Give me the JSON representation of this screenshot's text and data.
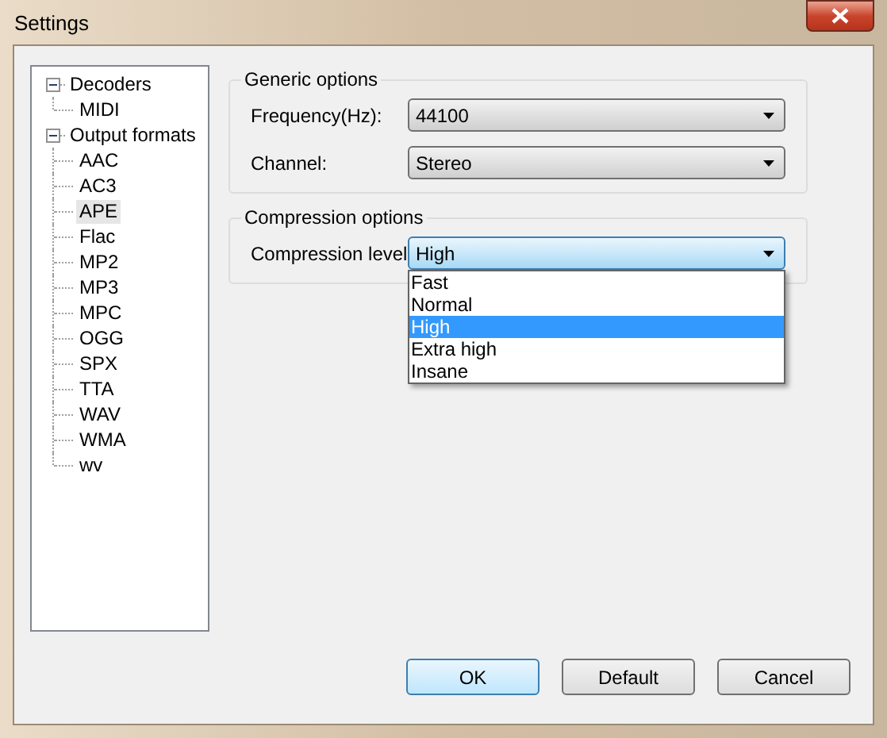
{
  "window": {
    "title": "Settings"
  },
  "tree": [
    {
      "label": "Decoders",
      "expanded": true,
      "selected": false,
      "children": [
        {
          "label": "MIDI",
          "selected": false
        }
      ]
    },
    {
      "label": "Output formats",
      "expanded": true,
      "selected": false,
      "children": [
        {
          "label": "AAC",
          "selected": false
        },
        {
          "label": "AC3",
          "selected": false
        },
        {
          "label": "APE",
          "selected": true
        },
        {
          "label": "Flac",
          "selected": false
        },
        {
          "label": "MP2",
          "selected": false
        },
        {
          "label": "MP3",
          "selected": false
        },
        {
          "label": "MPC",
          "selected": false
        },
        {
          "label": "OGG",
          "selected": false
        },
        {
          "label": "SPX",
          "selected": false
        },
        {
          "label": "TTA",
          "selected": false
        },
        {
          "label": "WAV",
          "selected": false
        },
        {
          "label": "WMA",
          "selected": false
        },
        {
          "label": "wv",
          "selected": false
        }
      ]
    }
  ],
  "groups": [
    {
      "title": "Generic options",
      "fields": [
        {
          "label": "Frequency(Hz):",
          "value": "44100",
          "focused": false,
          "expanded": false
        },
        {
          "label": "Channel:",
          "value": "Stereo",
          "focused": false,
          "expanded": false
        }
      ]
    },
    {
      "title": "Compression options",
      "fields": [
        {
          "label": "Compression level",
          "value": "High",
          "focused": true,
          "expanded": true,
          "options": [
            {
              "label": "Fast",
              "selected": false
            },
            {
              "label": "Normal",
              "selected": false
            },
            {
              "label": "High",
              "selected": true
            },
            {
              "label": "Extra high",
              "selected": false
            },
            {
              "label": "Insane",
              "selected": false
            }
          ]
        }
      ]
    }
  ],
  "buttons": [
    {
      "label": "OK",
      "default": true
    },
    {
      "label": "Default",
      "default": false
    },
    {
      "label": "Cancel",
      "default": false
    }
  ]
}
